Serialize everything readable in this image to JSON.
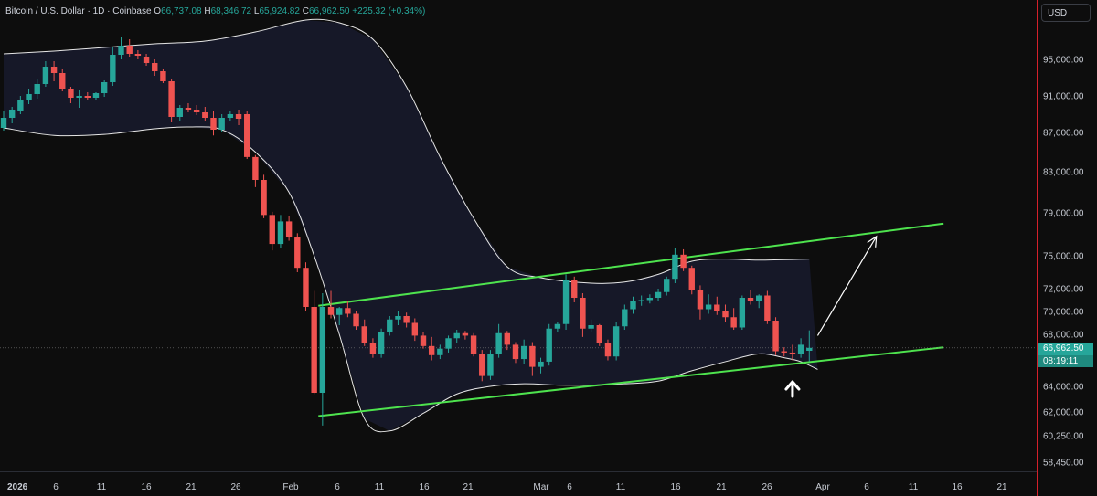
{
  "header": {
    "symbol": "Bitcoin / U.S. Dollar · 1D · Coinbase",
    "open_label": "O",
    "open": "66,737.08",
    "high_label": "H",
    "high": "68,346.72",
    "low_label": "L",
    "low": "65,924.82",
    "close_label": "C",
    "close": "66,962.50",
    "change": "+225.32 (+0.34%)"
  },
  "currency_button": "USD",
  "price_badge": "66,962.50",
  "timer_badge": "08:19:11",
  "colors": {
    "up": "#26a69a",
    "down": "#ef5350",
    "channel": "#4ee34e",
    "band": "#e6e6e6",
    "band_fill": "#1f2240",
    "background": "#0d0d0d"
  },
  "chart_data": {
    "type": "candlestick",
    "y_ticks": [
      "95,000.00",
      "91,000.00",
      "87,000.00",
      "83,000.00",
      "79,000.00",
      "75,000.00",
      "72,000.00",
      "70,000.00",
      "68,000.00",
      "64,000.00",
      "62,000.00",
      "60,250.00",
      "58,450.00"
    ],
    "x_ticks": [
      "2026",
      "6",
      "11",
      "16",
      "21",
      "26",
      "Feb",
      "6",
      "11",
      "16",
      "21",
      "Mar",
      "6",
      "11",
      "16",
      "21",
      "26",
      "Apr",
      "6",
      "11",
      "16",
      "21"
    ],
    "candles": [
      {
        "o": 87500,
        "h": 89300,
        "l": 87200,
        "c": 88600
      },
      {
        "o": 88600,
        "h": 89800,
        "l": 88000,
        "c": 89500
      },
      {
        "o": 89400,
        "h": 91000,
        "l": 89000,
        "c": 90600
      },
      {
        "o": 90500,
        "h": 91800,
        "l": 90100,
        "c": 91200
      },
      {
        "o": 91200,
        "h": 92900,
        "l": 90700,
        "c": 92300
      },
      {
        "o": 92300,
        "h": 94800,
        "l": 92000,
        "c": 94200
      },
      {
        "o": 94200,
        "h": 94800,
        "l": 92600,
        "c": 93500
      },
      {
        "o": 93500,
        "h": 94000,
        "l": 91500,
        "c": 91800
      },
      {
        "o": 91800,
        "h": 92000,
        "l": 90200,
        "c": 90800
      },
      {
        "o": 90800,
        "h": 91600,
        "l": 89700,
        "c": 91000
      },
      {
        "o": 91000,
        "h": 91400,
        "l": 90500,
        "c": 90800
      },
      {
        "o": 90800,
        "h": 91400,
        "l": 90600,
        "c": 91300
      },
      {
        "o": 91300,
        "h": 92700,
        "l": 90900,
        "c": 92500
      },
      {
        "o": 92500,
        "h": 96300,
        "l": 92100,
        "c": 95500
      },
      {
        "o": 95500,
        "h": 97500,
        "l": 95000,
        "c": 96500
      },
      {
        "o": 96500,
        "h": 97200,
        "l": 95300,
        "c": 95600
      },
      {
        "o": 95600,
        "h": 96000,
        "l": 95000,
        "c": 95400
      },
      {
        "o": 95300,
        "h": 95600,
        "l": 94300,
        "c": 94600
      },
      {
        "o": 94600,
        "h": 95000,
        "l": 93200,
        "c": 93700
      },
      {
        "o": 93700,
        "h": 94000,
        "l": 92400,
        "c": 92600
      },
      {
        "o": 92600,
        "h": 92900,
        "l": 88100,
        "c": 88700
      },
      {
        "o": 88700,
        "h": 90000,
        "l": 88300,
        "c": 89700
      },
      {
        "o": 89700,
        "h": 90200,
        "l": 89200,
        "c": 89500
      },
      {
        "o": 89500,
        "h": 90000,
        "l": 88900,
        "c": 89200
      },
      {
        "o": 89200,
        "h": 89800,
        "l": 88300,
        "c": 88600
      },
      {
        "o": 88600,
        "h": 89300,
        "l": 86700,
        "c": 87300
      },
      {
        "o": 87300,
        "h": 89000,
        "l": 87000,
        "c": 88600
      },
      {
        "o": 88600,
        "h": 89300,
        "l": 88300,
        "c": 89000
      },
      {
        "o": 89000,
        "h": 89500,
        "l": 87800,
        "c": 88500
      },
      {
        "o": 89000,
        "h": 89400,
        "l": 84300,
        "c": 84500
      },
      {
        "o": 84500,
        "h": 84700,
        "l": 81500,
        "c": 82200
      },
      {
        "o": 82200,
        "h": 82700,
        "l": 78500,
        "c": 78800
      },
      {
        "o": 78800,
        "h": 79100,
        "l": 75500,
        "c": 76100
      },
      {
        "o": 76100,
        "h": 78800,
        "l": 75700,
        "c": 78200
      },
      {
        "o": 78200,
        "h": 78700,
        "l": 76400,
        "c": 76700
      },
      {
        "o": 76700,
        "h": 77100,
        "l": 73500,
        "c": 73900
      },
      {
        "o": 73900,
        "h": 74400,
        "l": 70000,
        "c": 70400
      },
      {
        "o": 70400,
        "h": 71800,
        "l": 63400,
        "c": 63500
      },
      {
        "o": 63500,
        "h": 71600,
        "l": 61000,
        "c": 70400
      },
      {
        "o": 70400,
        "h": 71800,
        "l": 69400,
        "c": 69700
      },
      {
        "o": 69700,
        "h": 70400,
        "l": 68800,
        "c": 70300
      },
      {
        "o": 70300,
        "h": 70900,
        "l": 69500,
        "c": 69800
      },
      {
        "o": 69800,
        "h": 70000,
        "l": 68400,
        "c": 68700
      },
      {
        "o": 68700,
        "h": 69300,
        "l": 67100,
        "c": 67300
      },
      {
        "o": 67300,
        "h": 67700,
        "l": 66200,
        "c": 66500
      },
      {
        "o": 66500,
        "h": 68500,
        "l": 66200,
        "c": 68200
      },
      {
        "o": 68200,
        "h": 69600,
        "l": 67900,
        "c": 69300
      },
      {
        "o": 69300,
        "h": 70000,
        "l": 68800,
        "c": 69600
      },
      {
        "o": 69600,
        "h": 69900,
        "l": 68600,
        "c": 69000
      },
      {
        "o": 69000,
        "h": 69400,
        "l": 67500,
        "c": 67900
      },
      {
        "o": 67900,
        "h": 68200,
        "l": 66900,
        "c": 67100
      },
      {
        "o": 67100,
        "h": 67800,
        "l": 66000,
        "c": 66400
      },
      {
        "o": 66400,
        "h": 67200,
        "l": 66100,
        "c": 66900
      },
      {
        "o": 66900,
        "h": 67900,
        "l": 66600,
        "c": 67700
      },
      {
        "o": 67700,
        "h": 68400,
        "l": 67300,
        "c": 68100
      },
      {
        "o": 68100,
        "h": 68300,
        "l": 67600,
        "c": 67900
      },
      {
        "o": 67900,
        "h": 68100,
        "l": 66300,
        "c": 66500
      },
      {
        "o": 66500,
        "h": 66800,
        "l": 64400,
        "c": 64800
      },
      {
        "o": 64800,
        "h": 66800,
        "l": 64500,
        "c": 66500
      },
      {
        "o": 66500,
        "h": 68900,
        "l": 66200,
        "c": 68100
      },
      {
        "o": 68100,
        "h": 68300,
        "l": 66800,
        "c": 67200
      },
      {
        "o": 67200,
        "h": 67400,
        "l": 65800,
        "c": 66100
      },
      {
        "o": 66100,
        "h": 67600,
        "l": 65700,
        "c": 67100
      },
      {
        "o": 67100,
        "h": 67400,
        "l": 64800,
        "c": 65500
      },
      {
        "o": 65500,
        "h": 66200,
        "l": 65000,
        "c": 65900
      },
      {
        "o": 65900,
        "h": 68900,
        "l": 65600,
        "c": 68500
      },
      {
        "o": 68500,
        "h": 69100,
        "l": 68200,
        "c": 68900
      },
      {
        "o": 68900,
        "h": 73300,
        "l": 68400,
        "c": 72800
      },
      {
        "o": 72800,
        "h": 73100,
        "l": 70800,
        "c": 71200
      },
      {
        "o": 71200,
        "h": 71600,
        "l": 67800,
        "c": 68500
      },
      {
        "o": 68500,
        "h": 69300,
        "l": 68200,
        "c": 68800
      },
      {
        "o": 68800,
        "h": 68900,
        "l": 67100,
        "c": 67300
      },
      {
        "o": 67300,
        "h": 67600,
        "l": 66000,
        "c": 66300
      },
      {
        "o": 66300,
        "h": 69100,
        "l": 66000,
        "c": 68700
      },
      {
        "o": 68700,
        "h": 70600,
        "l": 68400,
        "c": 70200
      },
      {
        "o": 70200,
        "h": 71300,
        "l": 69800,
        "c": 70900
      },
      {
        "o": 70900,
        "h": 71400,
        "l": 70500,
        "c": 71000
      },
      {
        "o": 71000,
        "h": 71500,
        "l": 70700,
        "c": 71200
      },
      {
        "o": 71200,
        "h": 72000,
        "l": 70900,
        "c": 71700
      },
      {
        "o": 71700,
        "h": 73100,
        "l": 71400,
        "c": 72900
      },
      {
        "o": 72900,
        "h": 75700,
        "l": 72500,
        "c": 75100
      },
      {
        "o": 75100,
        "h": 75600,
        "l": 73600,
        "c": 73900
      },
      {
        "o": 73900,
        "h": 74100,
        "l": 71500,
        "c": 71900
      },
      {
        "o": 71900,
        "h": 72300,
        "l": 69300,
        "c": 70200
      },
      {
        "o": 70200,
        "h": 71500,
        "l": 69800,
        "c": 70600
      },
      {
        "o": 70600,
        "h": 71300,
        "l": 69700,
        "c": 70000
      },
      {
        "o": 70000,
        "h": 70600,
        "l": 69100,
        "c": 69500
      },
      {
        "o": 69500,
        "h": 70300,
        "l": 68400,
        "c": 68600
      },
      {
        "o": 68600,
        "h": 71400,
        "l": 68400,
        "c": 71200
      },
      {
        "o": 71200,
        "h": 71900,
        "l": 70600,
        "c": 70900
      },
      {
        "o": 70900,
        "h": 71500,
        "l": 70300,
        "c": 71400
      },
      {
        "o": 71400,
        "h": 71800,
        "l": 68900,
        "c": 69200
      },
      {
        "o": 69200,
        "h": 69500,
        "l": 66400,
        "c": 66700
      },
      {
        "o": 66700,
        "h": 67000,
        "l": 66300,
        "c": 66600
      },
      {
        "o": 66600,
        "h": 67200,
        "l": 66000,
        "c": 66500
      },
      {
        "o": 66500,
        "h": 67700,
        "l": 66200,
        "c": 67200
      },
      {
        "o": 66737,
        "h": 68347,
        "l": 65925,
        "c": 66962
      }
    ],
    "bollinger": {
      "upper": [
        [
          0,
          95600
        ],
        [
          6,
          95900
        ],
        [
          12,
          96300
        ],
        [
          18,
          96700
        ],
        [
          24,
          97000
        ],
        [
          30,
          98000
        ],
        [
          36,
          99300
        ],
        [
          40,
          99000
        ],
        [
          44,
          97200
        ],
        [
          48,
          92000
        ],
        [
          52,
          84500
        ],
        [
          56,
          78500
        ],
        [
          60,
          74000
        ],
        [
          64,
          73000
        ],
        [
          70,
          72500
        ],
        [
          74,
          72600
        ],
        [
          78,
          73300
        ],
        [
          82,
          74500
        ],
        [
          86,
          74700
        ],
        [
          90,
          74600
        ],
        [
          96,
          74700
        ]
      ],
      "lower": [
        [
          0,
          87500
        ],
        [
          6,
          86700
        ],
        [
          12,
          86800
        ],
        [
          18,
          87400
        ],
        [
          22,
          87600
        ],
        [
          26,
          87300
        ],
        [
          30,
          85000
        ],
        [
          34,
          81000
        ],
        [
          37,
          75000
        ],
        [
          40,
          68000
        ],
        [
          43,
          61500
        ],
        [
          46,
          60600
        ],
        [
          50,
          61900
        ],
        [
          54,
          63400
        ],
        [
          58,
          64000
        ],
        [
          62,
          64200
        ],
        [
          66,
          64100
        ],
        [
          70,
          64100
        ],
        [
          74,
          64200
        ],
        [
          78,
          64400
        ],
        [
          82,
          65200
        ],
        [
          86,
          65900
        ],
        [
          90,
          66500
        ],
        [
          93,
          66200
        ],
        [
          95,
          65900
        ],
        [
          97,
          65300
        ]
      ]
    },
    "channel": {
      "upper": [
        [
          37.5,
          70500
        ],
        [
          112,
          78000
        ]
      ],
      "lower": [
        [
          37.5,
          61700
        ],
        [
          112,
          67000
        ]
      ]
    },
    "last_price": 66962.5,
    "arrow_up_at_index": 94,
    "projection_arrow": {
      "from": [
        97,
        67900
      ],
      "to": [
        104,
        76800
      ]
    }
  }
}
